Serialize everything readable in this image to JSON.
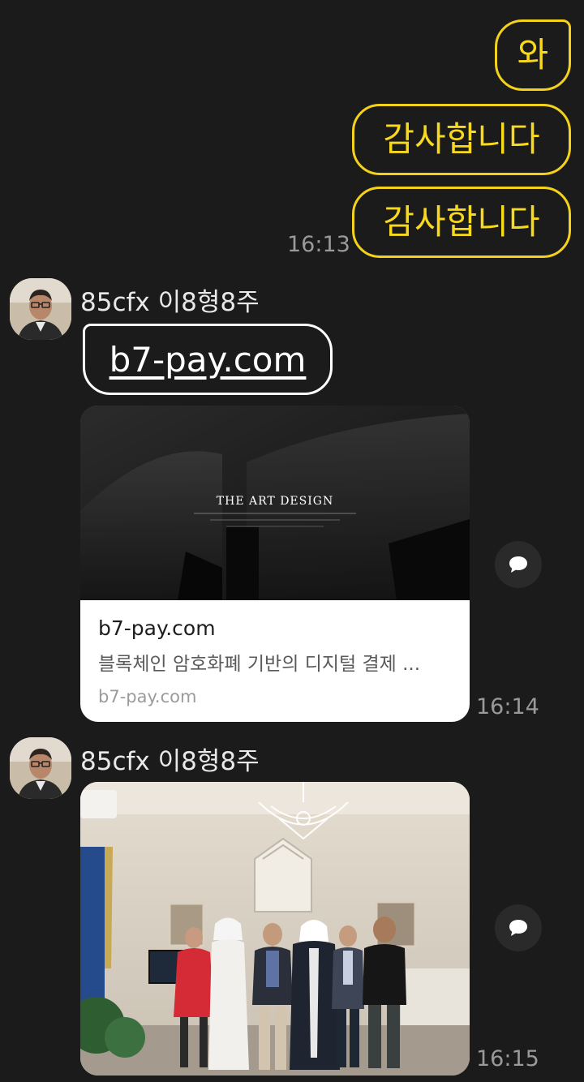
{
  "messages_out": [
    {
      "text": "와"
    },
    {
      "text": "감사합니다"
    },
    {
      "text": "감사합니다"
    }
  ],
  "time_out": "16:13",
  "link_message": {
    "sender": "85cfx 이8형8주",
    "link_text": "b7-pay.com",
    "preview": {
      "image_caption": "THE ART DESIGN",
      "title": "b7-pay.com",
      "description": "블록체인 암호화폐 기반의 디지털 결제 ...",
      "domain": "b7-pay.com"
    },
    "time": "16:14"
  },
  "photo_message": {
    "sender": "85cfx 이8형8주",
    "time": "16:15"
  },
  "icons": {
    "share": "share-speech-icon"
  },
  "colors": {
    "background": "#1b1b1b",
    "outgoing_border": "#f4d21c",
    "outgoing_text": "#f9d91c",
    "time": "#9a9a9a"
  }
}
